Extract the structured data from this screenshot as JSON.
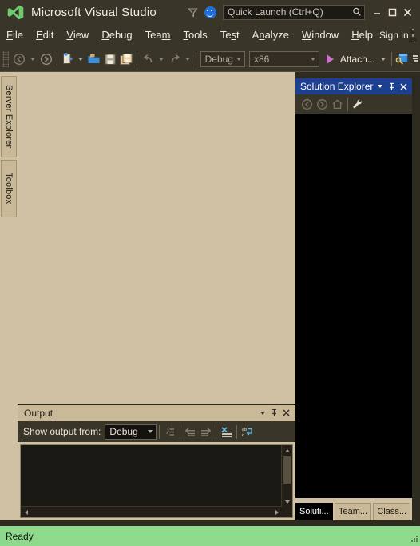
{
  "window": {
    "app_title": "Microsoft Visual Studio",
    "logo_icon": "visual-studio-logo-icon",
    "filter_icon": "funnel-filter-icon",
    "feedback_icon": "smiley-feedback-icon",
    "minimize_label": "–",
    "maximize_label": "❑",
    "close_label": "✕"
  },
  "quick_launch": {
    "placeholder": "Quick Launch (Ctrl+Q)",
    "value": "Quick Launch (Ctrl+Q)",
    "search_icon": "magnifier-search-icon"
  },
  "menu": {
    "items": [
      {
        "label": "File",
        "mnemonic": "F",
        "pre": "",
        "post": "ile"
      },
      {
        "label": "Edit",
        "mnemonic": "E",
        "pre": "",
        "post": "dit"
      },
      {
        "label": "View",
        "mnemonic": "V",
        "pre": "",
        "post": "iew"
      },
      {
        "label": "Debug",
        "mnemonic": "D",
        "pre": "",
        "post": "ebug"
      },
      {
        "label": "Team",
        "mnemonic": "m",
        "pre": "Tea",
        "post": ""
      },
      {
        "label": "Tools",
        "mnemonic": "T",
        "pre": "",
        "post": "ools"
      },
      {
        "label": "Test",
        "mnemonic": "s",
        "pre": "Te",
        "post": "t"
      },
      {
        "label": "Analyze",
        "mnemonic": "n",
        "pre": "A",
        "post": "alyze"
      },
      {
        "label": "Window",
        "mnemonic": "W",
        "pre": "",
        "post": "indow"
      },
      {
        "label": "Help",
        "mnemonic": "H",
        "pre": "",
        "post": "elp"
      }
    ],
    "sign_in_label": "Sign in",
    "avatar_icon": "user-avatar-icon"
  },
  "toolbar": {
    "grip_icon": "toolbar-grip-icon",
    "navigate_backward_icon": "navigate-backward-icon",
    "navigate_forward_icon": "navigate-forward-icon",
    "new_project_icon": "new-project-icon",
    "open_file_icon": "open-file-folder-icon",
    "save_icon": "save-icon",
    "save_all_icon": "save-all-icon",
    "undo_icon": "undo-arrow-icon",
    "redo_icon": "redo-arrow-icon",
    "solution_config": "Debug",
    "solution_platform": "x86",
    "run_icon": "run-play-icon",
    "attach_label": "Attach...",
    "attach_dropdown_icon": "chevron-down-icon",
    "attach_to_process_icon": "attach-to-process-key-icon",
    "overflow_icon": "toolbar-overflow-icon"
  },
  "left_dock": {
    "tabs": [
      {
        "label": "Server Explorer",
        "icon": "server-explorer-icon"
      },
      {
        "label": "Toolbox",
        "icon": "toolbox-icon"
      }
    ]
  },
  "output_pane": {
    "title": "Output",
    "dropdown_icon": "chevron-down-icon",
    "pin_icon": "pin-icon",
    "close_icon": "close-icon",
    "show_output_label_pre": "S",
    "show_output_label_mnemonic": "S",
    "show_output_label_post": "how output from:",
    "show_output_label": "Show output from:",
    "source_value": "Debug",
    "buttons": [
      {
        "name": "find-message-source-icon",
        "label": "Find Message Source"
      },
      {
        "name": "go-to-previous-message-icon",
        "label": "Go to Previous Message"
      },
      {
        "name": "go-to-next-message-icon",
        "label": "Go to Next Message"
      },
      {
        "name": "clear-all-icon",
        "label": "Clear All"
      },
      {
        "name": "toggle-word-wrap-icon",
        "label": "Toggle Word Wrap"
      }
    ],
    "content": ""
  },
  "solution_explorer": {
    "title": "Solution Explorer",
    "dropdown_icon": "chevron-down-icon",
    "pin_icon": "pin-icon",
    "close_icon": "close-icon",
    "toolbar": [
      {
        "name": "back-navigate-icon",
        "label": "Back"
      },
      {
        "name": "forward-navigate-icon",
        "label": "Forward"
      },
      {
        "name": "home-icon",
        "label": "Home"
      },
      {
        "name": "properties-wrench-icon",
        "label": "Properties"
      }
    ],
    "content": "",
    "tabs": [
      {
        "label": "Soluti...",
        "active": true
      },
      {
        "label": "Team...",
        "active": false
      },
      {
        "label": "Class...",
        "active": false
      }
    ]
  },
  "status_bar": {
    "text": "Ready",
    "resize_grip_icon": "resize-grip-icon"
  },
  "colors": {
    "title_bar": "#3a3529",
    "chrome_tan": "#d0c1a4",
    "tab_tan": "#c9b998",
    "solution_header_blue": "#1c3f8f",
    "status_green": "#8fd98d",
    "panel_black": "#000000",
    "play_magenta": "#cf6fd0"
  }
}
